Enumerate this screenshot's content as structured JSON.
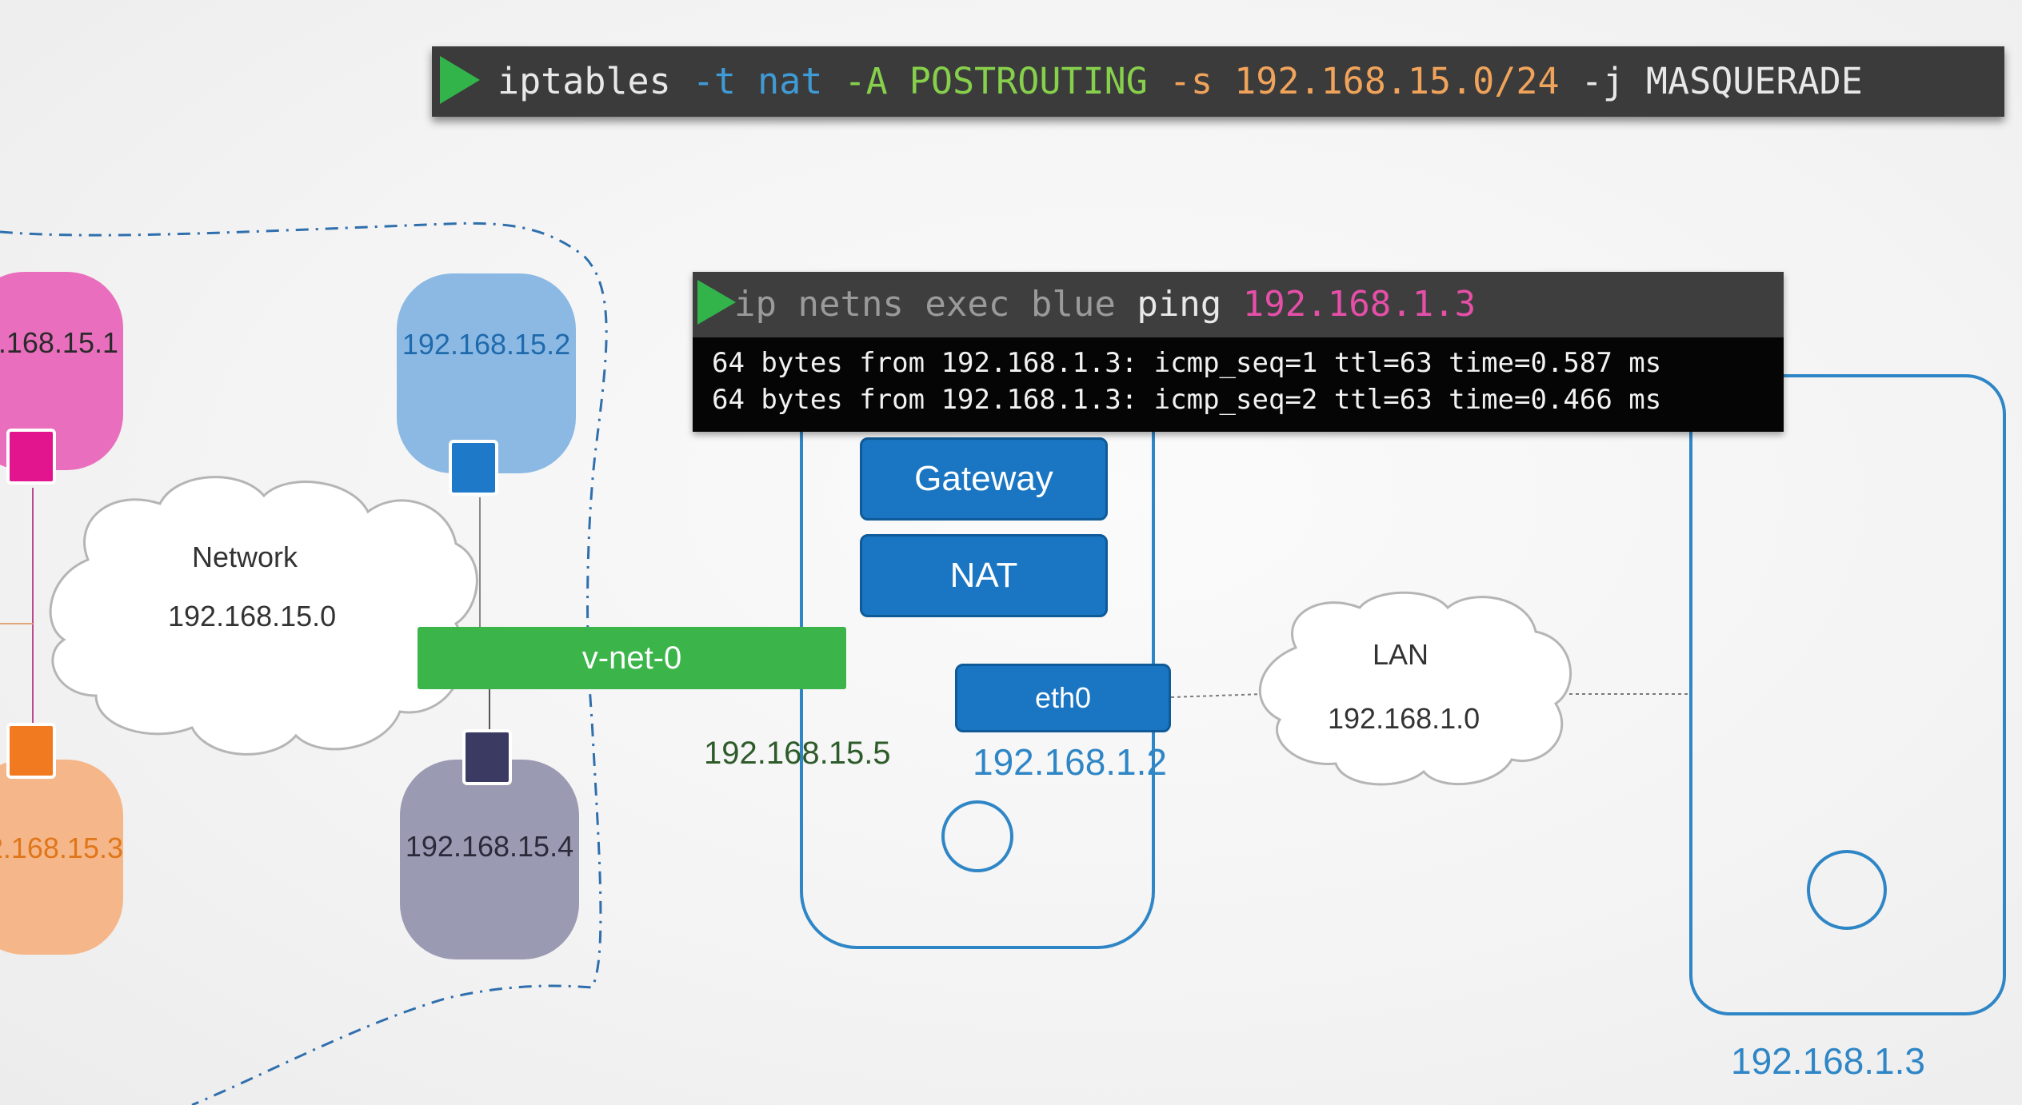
{
  "terminal1": {
    "segments": [
      {
        "text": "iptables ",
        "color": "white"
      },
      {
        "text": "-t ",
        "color": "blue"
      },
      {
        "text": "nat ",
        "color": "blue"
      },
      {
        "text": "-A POSTROUTING ",
        "color": "green"
      },
      {
        "text": "-s ",
        "color": "orange"
      },
      {
        "text": "192.168.15.0/24 ",
        "color": "orange"
      },
      {
        "text": "-j MASQUERADE",
        "color": "white"
      }
    ]
  },
  "terminal2": {
    "cmd_prefix": "ip netns exec blue ",
    "cmd_ping": "ping ",
    "cmd_ip": "192.168.1.3",
    "output": [
      "64 bytes from 192.168.1.3: icmp_seq=1 ttl=63 time=0.587 ms",
      "64 bytes from 192.168.1.3: icmp_seq=2 ttl=63 time=0.466 ms"
    ]
  },
  "hosts": {
    "h1": ".168.15.1",
    "h2": "192.168.15.2",
    "h3": "2.168.15.3",
    "h4": "192.168.15.4"
  },
  "network_cloud": {
    "title": "Network",
    "ip": "192.168.15.0"
  },
  "vnet": {
    "label": "v-net-0",
    "ip": "192.168.15.5"
  },
  "router": {
    "gateway": "Gateway",
    "nat": "NAT",
    "eth0": "eth0",
    "eth0_ip": "192.168.1.2"
  },
  "lan_cloud": {
    "title": "LAN",
    "ip": "192.168.1.0"
  },
  "remote_host": {
    "ip": "192.168.1.3"
  },
  "colors": {
    "pink": "#e96fbe",
    "magenta": "#e2148e",
    "light_blue": "#8bb9e4",
    "blue_square": "#1f79c9",
    "orange_host": "#f5b789",
    "orange_square": "#f1791f",
    "gray_host": "#9b9ab3",
    "navy_square": "#3b3a63",
    "green": "#3bb54a",
    "device_blue": "#1a76c2"
  }
}
